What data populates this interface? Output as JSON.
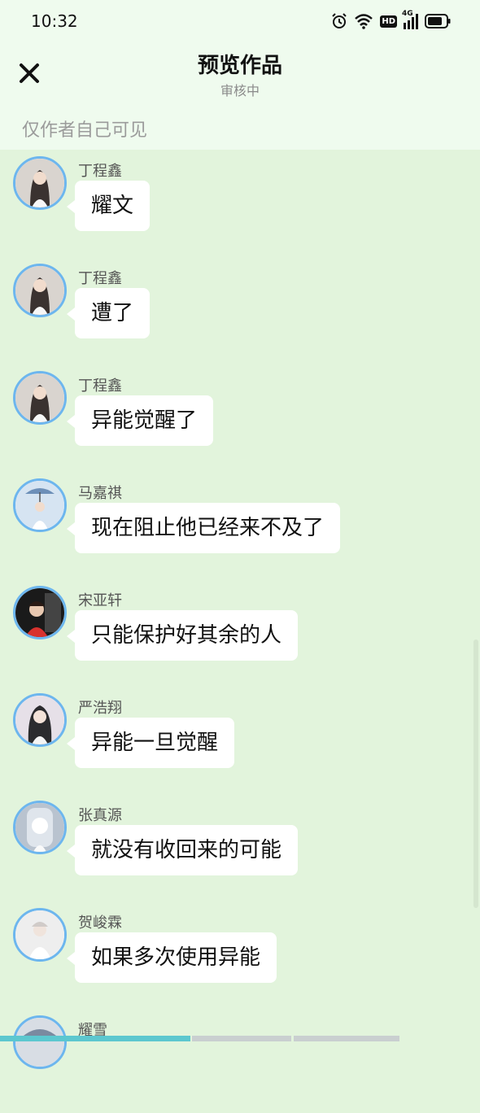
{
  "status_bar": {
    "time": "10:32",
    "network_label": "4G",
    "hd_label": "HD"
  },
  "header": {
    "title": "预览作品",
    "subtitle": "审核中"
  },
  "visibility_note": "仅作者自己可见",
  "messages": [
    {
      "name": "丁程鑫",
      "text": "耀文",
      "avatar_color": "#d9d4cf"
    },
    {
      "name": "丁程鑫",
      "text": "遭了",
      "avatar_color": "#d9d4cf"
    },
    {
      "name": "丁程鑫",
      "text": "异能觉醒了",
      "avatar_color": "#d9d4cf"
    },
    {
      "name": "马嘉祺",
      "text": "现在阻止他已经来不及了",
      "avatar_color": "#d6e4f2"
    },
    {
      "name": "宋亚轩",
      "text": "只能保护好其余的人",
      "avatar_color": "#1a1a1a"
    },
    {
      "name": "严浩翔",
      "text": "异能一旦觉醒",
      "avatar_color": "#e6e0e8"
    },
    {
      "name": "张真源",
      "text": "就没有收回来的可能",
      "avatar_color": "#b9c3cf"
    },
    {
      "name": "贺峻霖",
      "text": "如果多次使用异能",
      "avatar_color": "#eeeeee"
    },
    {
      "name": "耀雪",
      "text": "",
      "avatar_color": "#d8dde4"
    }
  ],
  "colors": {
    "accent": "#6db6ee",
    "background": "#e2f4dc",
    "header_bg": "#effbee"
  }
}
